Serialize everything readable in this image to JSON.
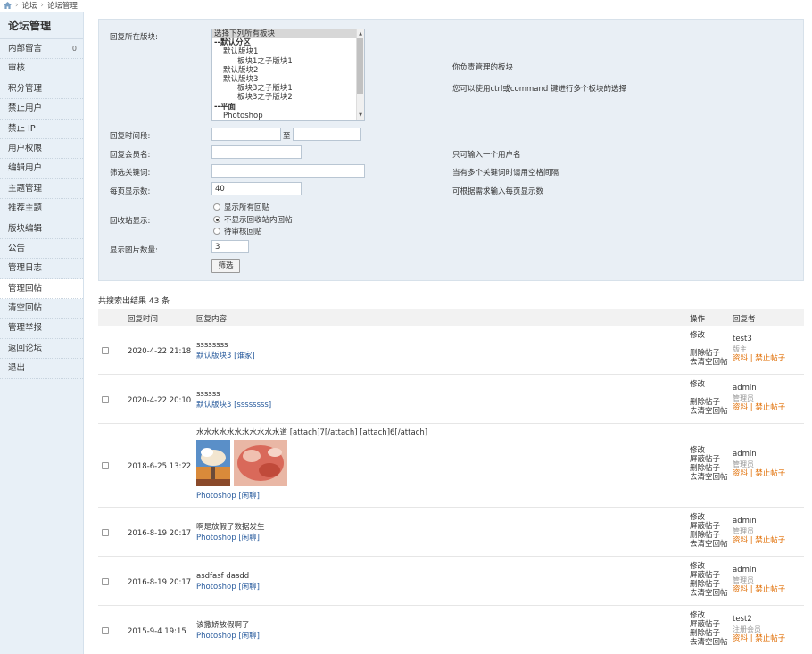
{
  "breadcrumb": {
    "items": [
      "论坛",
      "论坛管理"
    ]
  },
  "sidebar": {
    "title": "论坛管理",
    "items": [
      {
        "label": "内部留言",
        "badge": "0"
      },
      {
        "label": "审核"
      },
      {
        "label": "积分管理"
      },
      {
        "label": "禁止用户"
      },
      {
        "label": "禁止 IP"
      },
      {
        "label": "用户权限"
      },
      {
        "label": "编辑用户"
      },
      {
        "label": "主题管理"
      },
      {
        "label": "推荐主题"
      },
      {
        "label": "版块编辑"
      },
      {
        "label": "公告"
      },
      {
        "label": "管理日志"
      },
      {
        "label": "管理回帖"
      },
      {
        "label": "清空回帖"
      },
      {
        "label": "管理举报"
      },
      {
        "label": "返回论坛"
      },
      {
        "label": "退出"
      }
    ]
  },
  "filter": {
    "forum_label": "回复所在版块:",
    "forum_options": [
      "选择下列所有板块",
      "--默认分区",
      "默认版块1",
      "板块1之子版块1",
      "默认版块2",
      "默认版块3",
      "板块3之子版块1",
      "板块3之子版块2",
      "--平面",
      "Photoshop"
    ],
    "forum_hint1": "你负责管理的板块",
    "forum_hint2": "您可以使用ctrl或command 键进行多个板块的选择",
    "time_label": "回复时间段:",
    "time_to": "至",
    "member_label": "回复会员名:",
    "member_hint": "只可输入一个用户名",
    "keyword_label": "筛选关键词:",
    "keyword_hint": "当有多个关键词时请用空格间隔",
    "perpage_label": "每页显示数:",
    "perpage_value": "40",
    "perpage_hint": "可根据需求输入每页显示数",
    "recycle_label": "回收站显示:",
    "recycle_options": [
      "显示所有回贴",
      "不显示回收站内回帖",
      "待审核回贴"
    ],
    "recycle_selected": 1,
    "image_label": "显示图片数量:",
    "image_value": "3",
    "submit_label": "筛选"
  },
  "results": {
    "total_text": "共搜索出结果 43 条",
    "headers": {
      "time": "回复时间",
      "content": "回复内容",
      "ops": "操作",
      "user": "回复者"
    },
    "rows": [
      {
        "time": "2020-4-22 21:18",
        "text": "ssssssss",
        "forum": "默认版块3 [谁家]",
        "ops": [
          "修改",
          "",
          "删除帖子",
          "去清空回帖"
        ],
        "user": "test3",
        "role": "版主",
        "links": [
          "资料",
          "禁止帖子"
        ]
      },
      {
        "time": "2020-4-22 20:10",
        "text": "ssssss",
        "forum": "默认版块3 [ssssssss]",
        "ops": [
          "修改",
          "",
          "删除帖子",
          "去清空回帖"
        ],
        "user": "admin",
        "role": "管理员",
        "links": [
          "资料",
          "禁止帖子"
        ]
      },
      {
        "time": "2018-6-25 13:22",
        "text": "水水水水水水水水水水水道 [attach]7[/attach] [attach]6[/attach]",
        "forum": "Photoshop [闲聊]",
        "ops": [
          "修改",
          "屏蔽帖子",
          "删除帖子",
          "去清空回帖"
        ],
        "user": "admin",
        "role": "管理员",
        "links": [
          "资料",
          "禁止帖子"
        ],
        "images": 2
      },
      {
        "time": "2016-8-19 20:17",
        "text": "啊是放假了数据发生",
        "forum": "Photoshop [闲聊]",
        "ops": [
          "修改",
          "屏蔽帖子",
          "删除帖子",
          "去清空回帖"
        ],
        "user": "admin",
        "role": "管理员",
        "links": [
          "资料",
          "禁止帖子"
        ]
      },
      {
        "time": "2016-8-19 20:17",
        "text": "asdfasf dasdd",
        "forum": "Photoshop [闲聊]",
        "ops": [
          "修改",
          "屏蔽帖子",
          "删除帖子",
          "去清空回帖"
        ],
        "user": "admin",
        "role": "管理员",
        "links": [
          "资料",
          "禁止帖子"
        ]
      },
      {
        "time": "2015-9-4 19:15",
        "text": "该撒娇放假啊了",
        "forum": "Photoshop [闲聊]",
        "ops": [
          "修改",
          "屏蔽帖子",
          "删除帖子",
          "去清空回帖"
        ],
        "user": "test2",
        "role": "注册会员",
        "links": [
          "资料",
          "禁止帖子"
        ]
      }
    ]
  }
}
